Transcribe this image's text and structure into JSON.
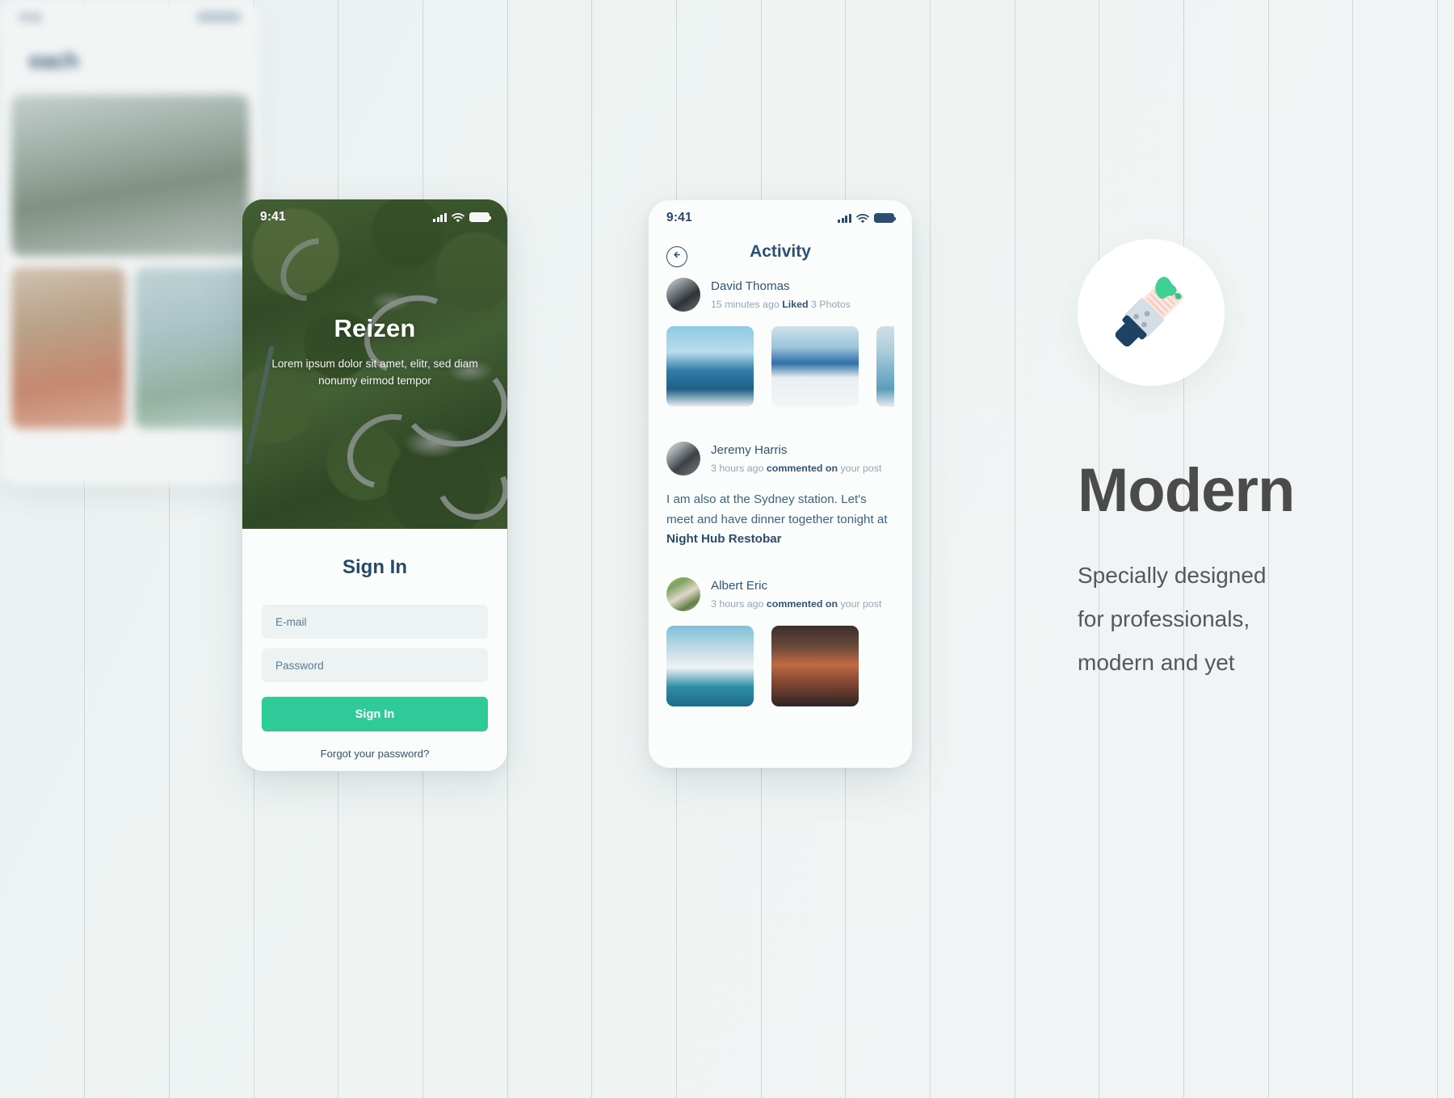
{
  "canvas": {
    "background_color": "#eef3f3",
    "guide_line_color": "#a0b0b0"
  },
  "signin_screen": {
    "status_bar": {
      "time": "9:41",
      "icons": [
        "signal-bars-icon",
        "wifi-icon",
        "battery-icon"
      ]
    },
    "hero": {
      "title": "Reizen",
      "subtitle": "Lorem ipsum dolor sit amet, elitr, sed diam nonumy eirmod tempor"
    },
    "heading": "Sign In",
    "email_placeholder": "E-mail",
    "email_value": "",
    "password_placeholder": "Password",
    "password_value": "",
    "submit_label": "Sign In",
    "forgot_label": "Forgot your password?",
    "accent_color": "#2ecb98",
    "heading_color": "#27496b",
    "field_bg_color": "#edf3f2"
  },
  "activity_screen": {
    "status_bar": {
      "time": "9:41",
      "icons": [
        "signal-bars-icon",
        "wifi-icon",
        "battery-icon"
      ]
    },
    "back_icon": "circle-arrow-left-icon",
    "title": "Activity",
    "items": [
      {
        "name": "David Thomas",
        "time": "15 minutes ago",
        "action": "Liked",
        "object": "3 Photos",
        "avatar": "avatar-david",
        "thumbnails": [
          "photo-sailboat-jump",
          "photo-santorini-domes",
          "photo-catamaran"
        ]
      },
      {
        "name": "Jeremy Harris",
        "time": "3 hours ago",
        "action": "commented on",
        "object": "your post",
        "avatar": "avatar-jeremy",
        "comment_prefix": "I am also at the Sydney station. Let's meet and have dinner together tonight at ",
        "comment_highlight": "Night Hub Restobar"
      },
      {
        "name": "Albert Eric",
        "time": "3 hours ago",
        "action": "commented on",
        "object": "your post",
        "avatar": "avatar-albert",
        "thumbnails": [
          "photo-sydney-opera-house",
          "photo-street-night"
        ]
      }
    ]
  },
  "promo": {
    "badge_icon": "paint-brush-icon",
    "title": "Modern",
    "body": "Specially designed\nfor professionals,\nmodern and yet",
    "title_color": "#4b4b4b",
    "body_color": "#55585a"
  }
}
